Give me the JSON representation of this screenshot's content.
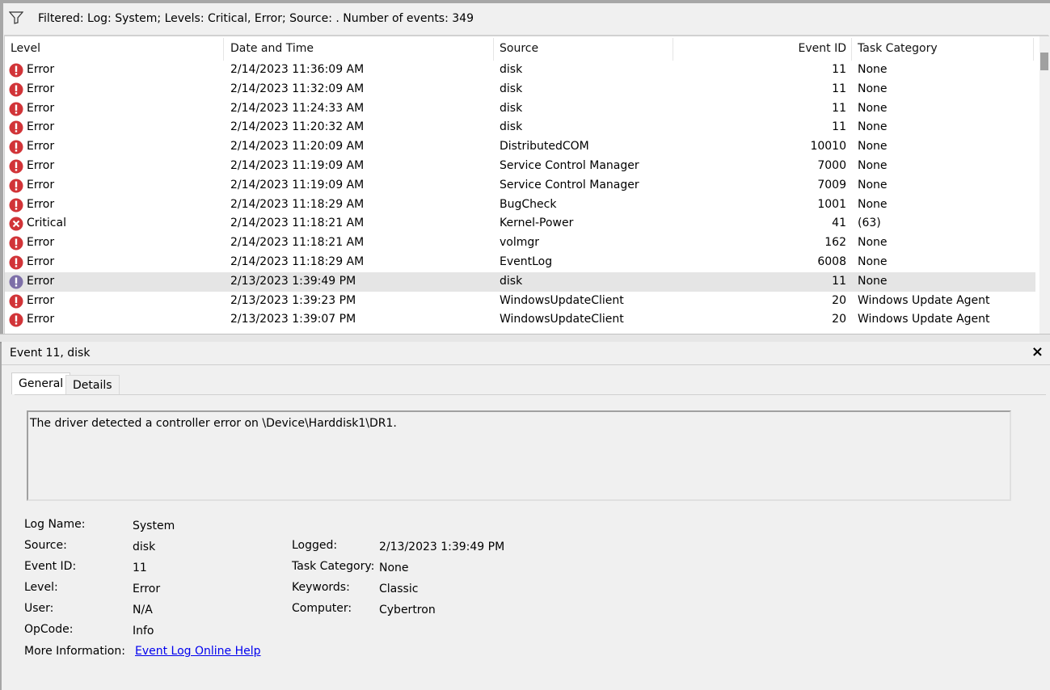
{
  "filter": {
    "icon": "filter-icon",
    "text": "Filtered: Log: System; Levels: Critical, Error; Source: . Number of events: 349"
  },
  "columns": {
    "level": "Level",
    "date": "Date and Time",
    "source": "Source",
    "event_id": "Event ID",
    "task_category": "Task Category"
  },
  "events": [
    {
      "level": "Error",
      "date": "2/14/2023 11:36:09 AM",
      "source": "disk",
      "event_id": "11",
      "task_category": "None",
      "icon": "error-icon"
    },
    {
      "level": "Error",
      "date": "2/14/2023 11:32:09 AM",
      "source": "disk",
      "event_id": "11",
      "task_category": "None",
      "icon": "error-icon"
    },
    {
      "level": "Error",
      "date": "2/14/2023 11:24:33 AM",
      "source": "disk",
      "event_id": "11",
      "task_category": "None",
      "icon": "error-icon"
    },
    {
      "level": "Error",
      "date": "2/14/2023 11:20:32 AM",
      "source": "disk",
      "event_id": "11",
      "task_category": "None",
      "icon": "error-icon"
    },
    {
      "level": "Error",
      "date": "2/14/2023 11:20:09 AM",
      "source": "DistributedCOM",
      "event_id": "10010",
      "task_category": "None",
      "icon": "error-icon"
    },
    {
      "level": "Error",
      "date": "2/14/2023 11:19:09 AM",
      "source": "Service Control Manager",
      "event_id": "7000",
      "task_category": "None",
      "icon": "error-icon"
    },
    {
      "level": "Error",
      "date": "2/14/2023 11:19:09 AM",
      "source": "Service Control Manager",
      "event_id": "7009",
      "task_category": "None",
      "icon": "error-icon"
    },
    {
      "level": "Error",
      "date": "2/14/2023 11:18:29 AM",
      "source": "BugCheck",
      "event_id": "1001",
      "task_category": "None",
      "icon": "error-icon"
    },
    {
      "level": "Critical",
      "date": "2/14/2023 11:18:21 AM",
      "source": "Kernel-Power",
      "event_id": "41",
      "task_category": "(63)",
      "icon": "critical-icon"
    },
    {
      "level": "Error",
      "date": "2/14/2023 11:18:21 AM",
      "source": "volmgr",
      "event_id": "162",
      "task_category": "None",
      "icon": "error-icon"
    },
    {
      "level": "Error",
      "date": "2/14/2023 11:18:29 AM",
      "source": "EventLog",
      "event_id": "6008",
      "task_category": "None",
      "icon": "error-icon"
    },
    {
      "level": "Error",
      "date": "2/13/2023 1:39:49 PM",
      "source": "disk",
      "event_id": "11",
      "task_category": "None",
      "icon": "error-icon",
      "selected": true
    },
    {
      "level": "Error",
      "date": "2/13/2023 1:39:23 PM",
      "source": "WindowsUpdateClient",
      "event_id": "20",
      "task_category": "Windows Update Agent",
      "icon": "error-icon"
    },
    {
      "level": "Error",
      "date": "2/13/2023 1:39:07 PM",
      "source": "WindowsUpdateClient",
      "event_id": "20",
      "task_category": "Windows Update Agent",
      "icon": "error-icon"
    }
  ],
  "details": {
    "title": "Event 11, disk",
    "close_label": "×",
    "tabs": {
      "general": "General",
      "details": "Details"
    },
    "description": "The driver detected a controller error on \\Device\\Harddisk1\\DR1.",
    "labels": {
      "log_name": "Log Name:",
      "source": "Source:",
      "event_id": "Event ID:",
      "level": "Level:",
      "user": "User:",
      "opcode": "OpCode:",
      "more_info": "More Information:",
      "logged": "Logged:",
      "task_category": "Task Category:",
      "keywords": "Keywords:",
      "computer": "Computer:"
    },
    "values": {
      "log_name": "System",
      "source": "disk",
      "event_id": "11",
      "level": "Error",
      "user": "N/A",
      "opcode": "Info",
      "more_info_link": "Event Log Online Help",
      "logged": "2/13/2023 1:39:49 PM",
      "task_category": "None",
      "keywords": "Classic",
      "computer": "Cybertron"
    }
  },
  "colors": {
    "error_red": "#d13438",
    "selected_row": "#e5e5e5",
    "link_blue": "#0000ee"
  }
}
